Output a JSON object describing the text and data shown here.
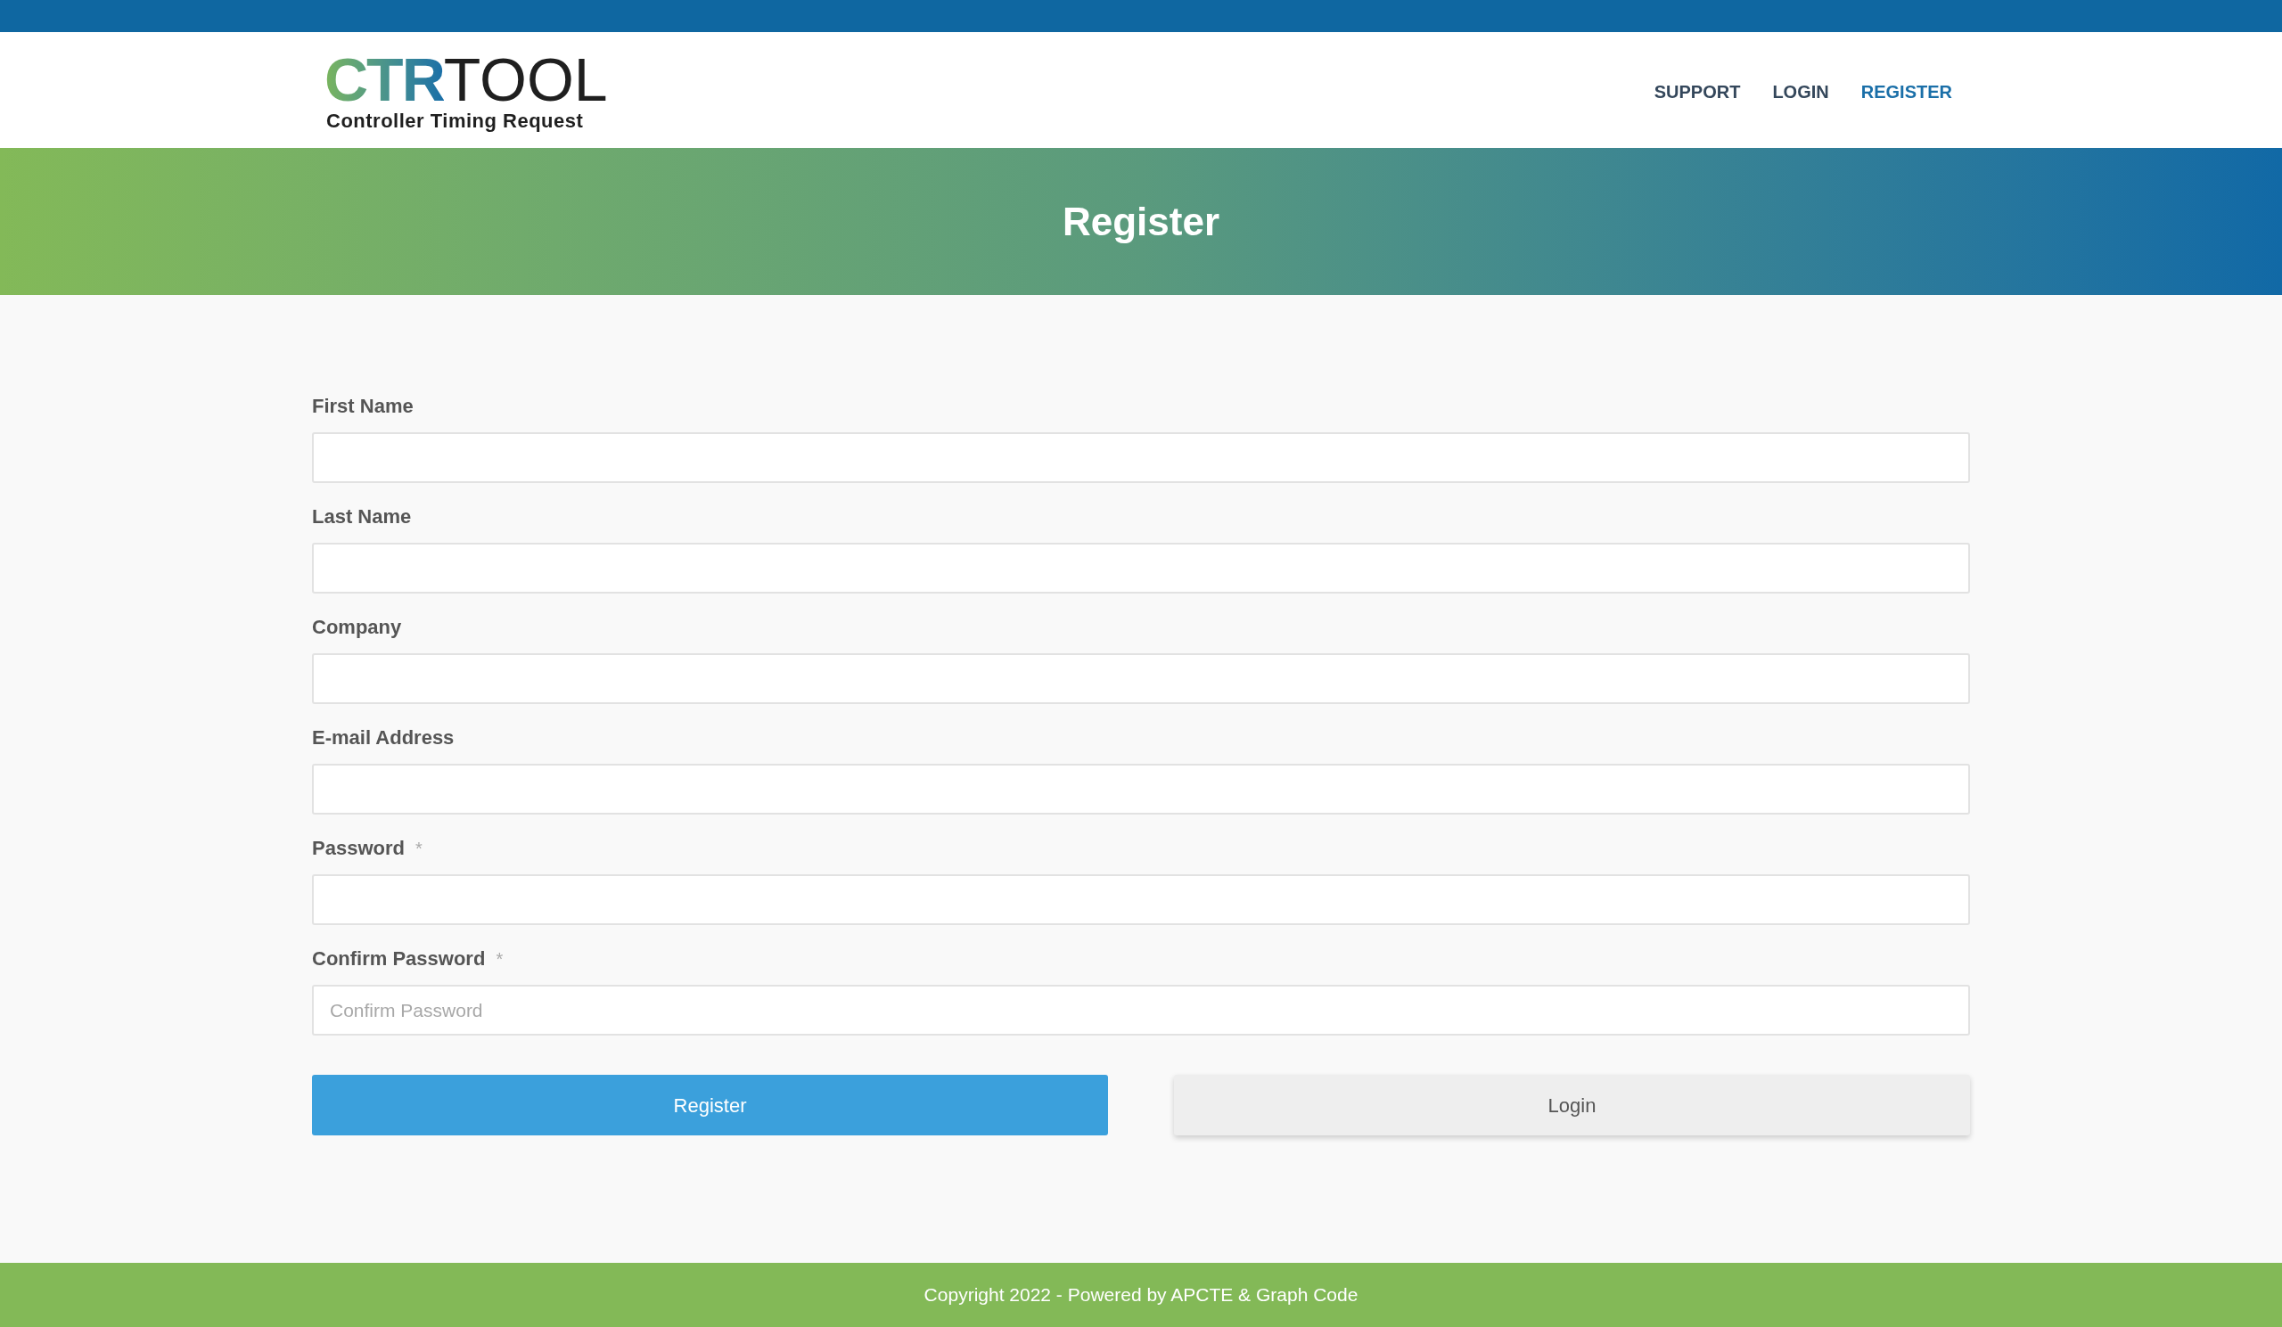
{
  "logo": {
    "mark": "CTR",
    "word": "TOOL",
    "tagline": "Controller Timing Request"
  },
  "nav": [
    {
      "label": "SUPPORT",
      "selected": false
    },
    {
      "label": "LOGIN",
      "selected": false
    },
    {
      "label": "REGISTER",
      "selected": true
    }
  ],
  "banner": {
    "title": "Register"
  },
  "form": {
    "fields": [
      {
        "label": "First Name"
      },
      {
        "label": "Last Name"
      },
      {
        "label": "Company"
      },
      {
        "label": "E-mail Address"
      },
      {
        "label": "Password",
        "required_mark": "*"
      },
      {
        "label": "Confirm Password",
        "required_mark": "*",
        "placeholder": "Confirm Password"
      }
    ],
    "buttons": [
      {
        "label": "Register",
        "kind": "primary"
      },
      {
        "label": "Login",
        "kind": "secondary"
      }
    ]
  },
  "footer": {
    "text": "Copyright 2022 - Powered by APCTE & Graph Code"
  }
}
